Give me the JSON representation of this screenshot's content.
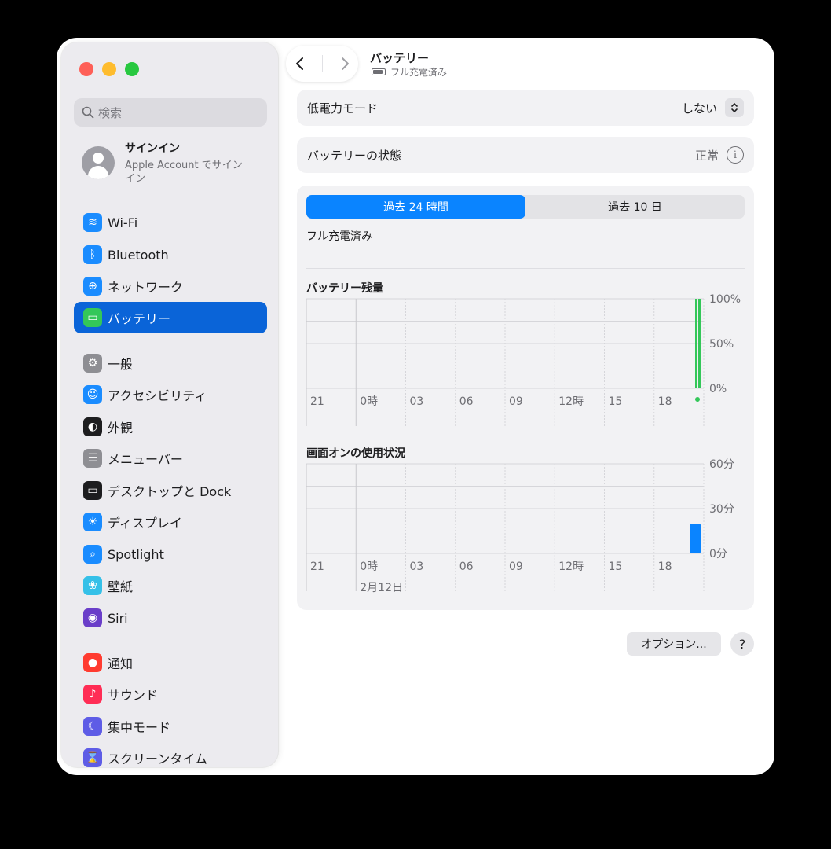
{
  "sidebar": {
    "search_placeholder": "検索",
    "account": {
      "title": "サインイン",
      "subtitle": "Apple Account でサインイン"
    },
    "items": [
      {
        "label": "Wi-Fi",
        "icon": "wifi-icon",
        "color": "#1a8cff"
      },
      {
        "label": "Bluetooth",
        "icon": "bluetooth-icon",
        "color": "#1a8cff"
      },
      {
        "label": "ネットワーク",
        "icon": "globe-icon",
        "color": "#1a8cff"
      },
      {
        "label": "バッテリー",
        "icon": "battery-icon",
        "color": "#34c759"
      },
      {
        "label": "一般",
        "icon": "gear-icon",
        "color": "#8e8e93"
      },
      {
        "label": "アクセシビリティ",
        "icon": "accessibility-icon",
        "color": "#1a8cff"
      },
      {
        "label": "外観",
        "icon": "appearance-icon",
        "color": "#1d1d1f"
      },
      {
        "label": "メニューバー",
        "icon": "menubar-icon",
        "color": "#8e8e93"
      },
      {
        "label": "デスクトップと Dock",
        "icon": "dock-icon",
        "color": "#1d1d1f"
      },
      {
        "label": "ディスプレイ",
        "icon": "display-icon",
        "color": "#1a8cff"
      },
      {
        "label": "Spotlight",
        "icon": "spotlight-icon",
        "color": "#1a8cff"
      },
      {
        "label": "壁紙",
        "icon": "wallpaper-icon",
        "color": "#35c0e8"
      },
      {
        "label": "Siri",
        "icon": "siri-icon",
        "color": "#6a3ec9"
      },
      {
        "label": "通知",
        "icon": "notifications-icon",
        "color": "#ff3b30"
      },
      {
        "label": "サウンド",
        "icon": "sound-icon",
        "color": "#ff2d55"
      },
      {
        "label": "集中モード",
        "icon": "focus-icon",
        "color": "#5e5ce6"
      },
      {
        "label": "スクリーンタイム",
        "icon": "hourglass-icon",
        "color": "#5e5ce6"
      }
    ]
  },
  "header": {
    "title": "バッテリー",
    "subtitle": "フル充電済み"
  },
  "low_power": {
    "label": "低電力モード",
    "value": "しない"
  },
  "battery_health": {
    "label": "バッテリーの状態",
    "value": "正常"
  },
  "usage": {
    "tabs": [
      "過去 24 時間",
      "過去 10 日"
    ],
    "status": "フル充電済み",
    "battery_title": "バッテリー残量",
    "screen_title": "画面オンの使用状況",
    "date_label": "2月12日"
  },
  "chart_data": [
    {
      "type": "bar",
      "title": "バッテリー残量",
      "categories": [
        "21",
        "0時",
        "03",
        "06",
        "09",
        "12時",
        "15",
        "18"
      ],
      "y_ticks": [
        "100%",
        "50%",
        "0%"
      ],
      "ylim": [
        0,
        100
      ],
      "series": [
        {
          "values": [
            0,
            0,
            0,
            0,
            0,
            0,
            0,
            100
          ]
        }
      ],
      "color": "#34c759"
    },
    {
      "type": "bar",
      "title": "画面オンの使用状況",
      "categories": [
        "21",
        "0時",
        "03",
        "06",
        "09",
        "12時",
        "15",
        "18"
      ],
      "y_ticks": [
        "60分",
        "30分",
        "0分"
      ],
      "ylim": [
        0,
        60
      ],
      "series": [
        {
          "values": [
            0,
            0,
            0,
            0,
            0,
            0,
            0,
            20
          ]
        }
      ],
      "color": "#0a84ff"
    }
  ],
  "buttons": {
    "options": "オプション...",
    "help": "?"
  }
}
